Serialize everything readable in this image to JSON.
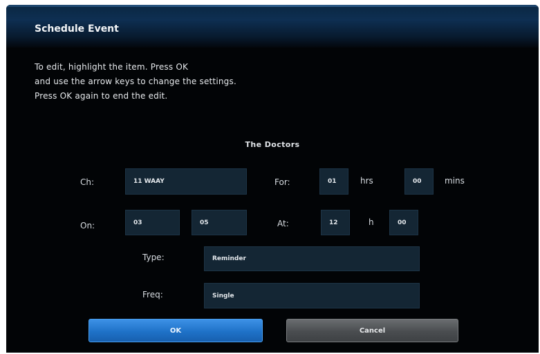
{
  "dialog": {
    "title": "Schedule Event",
    "instructions": [
      "To edit, highlight the item. Press OK",
      "and use the arrow keys to change the settings.",
      "Press OK again to end the edit."
    ],
    "program_title": "The Doctors"
  },
  "form": {
    "channel": {
      "label": "Ch:",
      "value": "11 WAAY"
    },
    "duration": {
      "label": "For:",
      "hours": "01",
      "hours_unit": "hrs",
      "minutes": "00",
      "minutes_unit": "mins"
    },
    "date": {
      "label": "On:",
      "month": "03",
      "day": "05"
    },
    "time": {
      "label": "At:",
      "hour": "12",
      "hour_unit": "h",
      "minute": "00"
    },
    "type": {
      "label": "Type:",
      "value": "Reminder"
    },
    "frequency": {
      "label": "Freq:",
      "value": "Single"
    }
  },
  "buttons": {
    "ok_label": "OK",
    "cancel_label": "Cancel"
  },
  "colors": {
    "background": "#020406",
    "header": "#0e2f52",
    "field": "#142634",
    "ok_button": "#1f72c8",
    "cancel_button": "#4a4d50"
  }
}
